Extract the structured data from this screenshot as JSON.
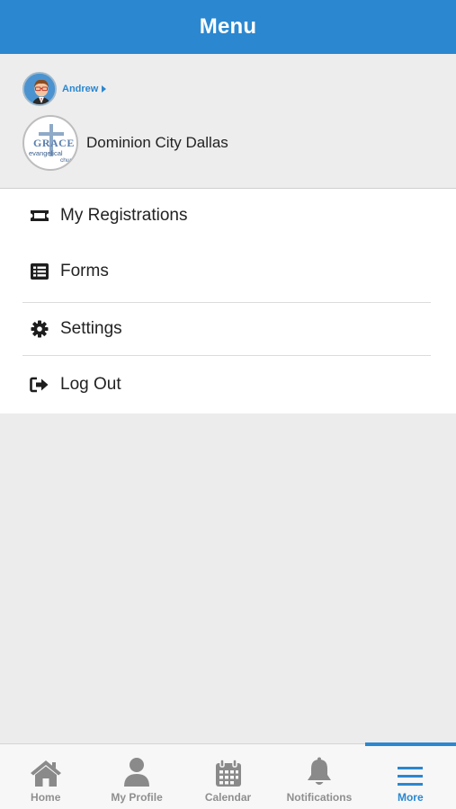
{
  "header": {
    "title": "Menu"
  },
  "profile": {
    "user_name": "Andrew",
    "church_name": "Dominion City Dallas",
    "church_logo_text": {
      "line1": "GRACE",
      "line2": "evangelical",
      "line3": "church"
    }
  },
  "menu": {
    "items": [
      {
        "label": "My Registrations",
        "icon": "ticket-icon"
      },
      {
        "label": "Forms",
        "icon": "list-icon"
      },
      {
        "label": "Settings",
        "icon": "gear-icon"
      },
      {
        "label": "Log Out",
        "icon": "sign-out-icon"
      }
    ]
  },
  "tabbar": {
    "tabs": [
      {
        "label": "Home",
        "icon": "home-icon"
      },
      {
        "label": "My Profile",
        "icon": "user-icon"
      },
      {
        "label": "Calendar",
        "icon": "calendar-icon"
      },
      {
        "label": "Notifications",
        "icon": "bell-icon"
      },
      {
        "label": "More",
        "icon": "hamburger-icon",
        "active": true
      }
    ]
  },
  "colors": {
    "accent": "#2b87cf",
    "inactive": "#8f8f8f",
    "background": "#ececec"
  }
}
